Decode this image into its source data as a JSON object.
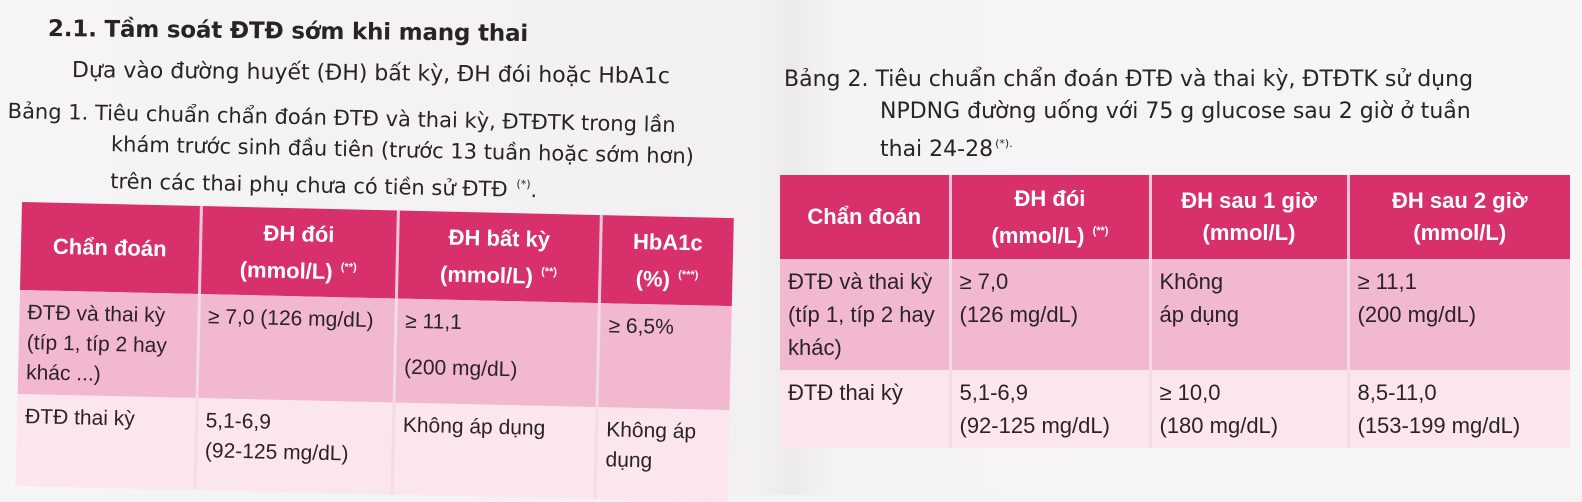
{
  "left": {
    "section_title": "2.1. Tầm soát ĐTĐ sớm khi mang thai",
    "intro": "Dựa vào đường huyết (ĐH) bất kỳ, ĐH đói hoặc HbA1c",
    "caption": {
      "line1": "Bảng 1. Tiêu chuẩn chẩn đoán ĐTĐ và thai kỳ, ĐTĐTK trong lần",
      "line2": "khám trước sinh đầu tiên (trước 13 tuần hoặc sớm hơn)",
      "line3": "trên các thai phụ chưa có tiền sử ĐTĐ",
      "mark": "(*)",
      "end": "."
    },
    "table": {
      "headers": [
        {
          "text": "Chẩn đoán",
          "sub": "",
          "mark": ""
        },
        {
          "text": "ĐH đói",
          "sub": "(mmol/L)",
          "mark": "(**)"
        },
        {
          "text": "ĐH bất kỳ",
          "sub": "(mmol/L)",
          "mark": "(**)"
        },
        {
          "text": "HbA1c",
          "sub": "(%)",
          "mark": "(***)"
        }
      ],
      "rows": [
        [
          "ĐTĐ và thai kỳ (típ 1, típ 2 hay khác ...)",
          "≥ 7,0 (126 mg/dL)",
          "≥ 11,1",
          "≥ 6,5%"
        ],
        [
          "ĐTĐ thai kỳ",
          "5,1-6,9",
          "Không áp dụng",
          "Không áp dụng"
        ]
      ],
      "row0_col2_line2": "(200 mg/dL)",
      "row1_col1_line2": "(92-125 mg/dL)"
    }
  },
  "right": {
    "caption": {
      "line1": "Bảng 2. Tiêu chuẩn chẩn đoán ĐTĐ và thai kỳ, ĐTĐTK sử dụng",
      "line2": "NPDNG đường uống với 75 g glucose sau 2 giờ ở tuần",
      "line3": "thai 24-28",
      "mark": "(*)."
    },
    "table": {
      "headers": [
        {
          "text": "Chẩn đoán",
          "sub": "",
          "mark": ""
        },
        {
          "text": "ĐH đói",
          "sub": "(mmol/L)",
          "mark": "(**)"
        },
        {
          "text": "ĐH sau 1 giờ",
          "sub": "(mmol/L)",
          "mark": ""
        },
        {
          "text": "ĐH sau 2 giờ",
          "sub": "(mmol/L)",
          "mark": ""
        }
      ],
      "rows": [
        {
          "c0": "ĐTĐ và thai kỳ (típ 1, típ 2 hay khác)",
          "c1a": "≥ 7,0",
          "c1b": "(126 mg/dL)",
          "c2a": "Không",
          "c2b": "áp dụng",
          "c3a": "≥ 11,1",
          "c3b": "(200 mg/dL)"
        },
        {
          "c0": "ĐTĐ thai kỳ",
          "c1a": "5,1-6,9",
          "c1b": "(92-125 mg/dL)",
          "c2a": "≥ 10,0",
          "c2b": "(180 mg/dL)",
          "c3a": "8,5-11,0",
          "c3b": "(153-199 mg/dL)"
        }
      ]
    }
  }
}
